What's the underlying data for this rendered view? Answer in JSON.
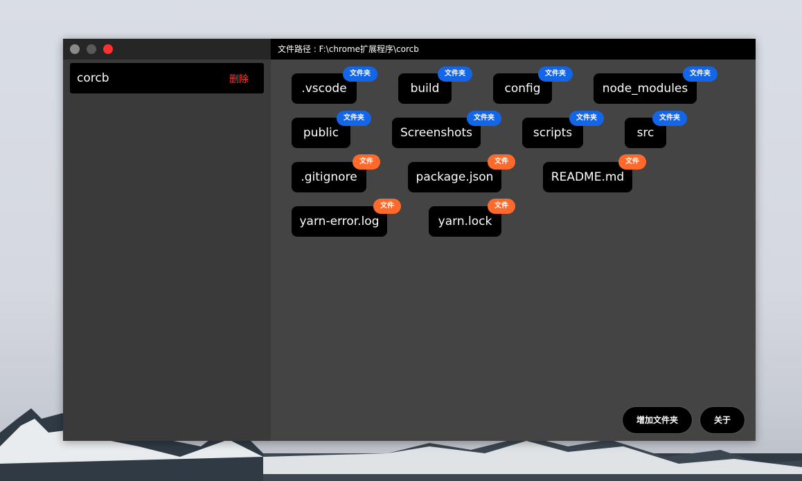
{
  "window": {
    "controls": [
      "minimize",
      "maximize",
      "close"
    ],
    "colors": {
      "close": "#ff3030",
      "badge_folder": "#1366e8",
      "badge_file": "#ff6a2c",
      "delete_text": "#ff3b30"
    }
  },
  "sidebar": {
    "projects": [
      {
        "name": "corcb",
        "delete_label": "删除"
      }
    ]
  },
  "path": {
    "label": "文件路径 : F:\\chrome扩展程序\\corcb"
  },
  "items": [
    {
      "name": ".vscode",
      "type_label": "文件夹"
    },
    {
      "name": "build",
      "type_label": "文件夹"
    },
    {
      "name": "config",
      "type_label": "文件夹"
    },
    {
      "name": "node_modules",
      "type_label": "文件夹"
    },
    {
      "name": "public",
      "type_label": "文件夹"
    },
    {
      "name": "Screenshots",
      "type_label": "文件夹"
    },
    {
      "name": "scripts",
      "type_label": "文件夹"
    },
    {
      "name": "src",
      "type_label": "文件夹"
    },
    {
      "name": ".gitignore",
      "type_label": "文件"
    },
    {
      "name": "package.json",
      "type_label": "文件"
    },
    {
      "name": "README.md",
      "type_label": "文件"
    },
    {
      "name": "yarn-error.log",
      "type_label": "文件"
    },
    {
      "name": "yarn.lock",
      "type_label": "文件"
    }
  ],
  "actions": {
    "add_folder": "增加文件夹",
    "about": "关于"
  }
}
